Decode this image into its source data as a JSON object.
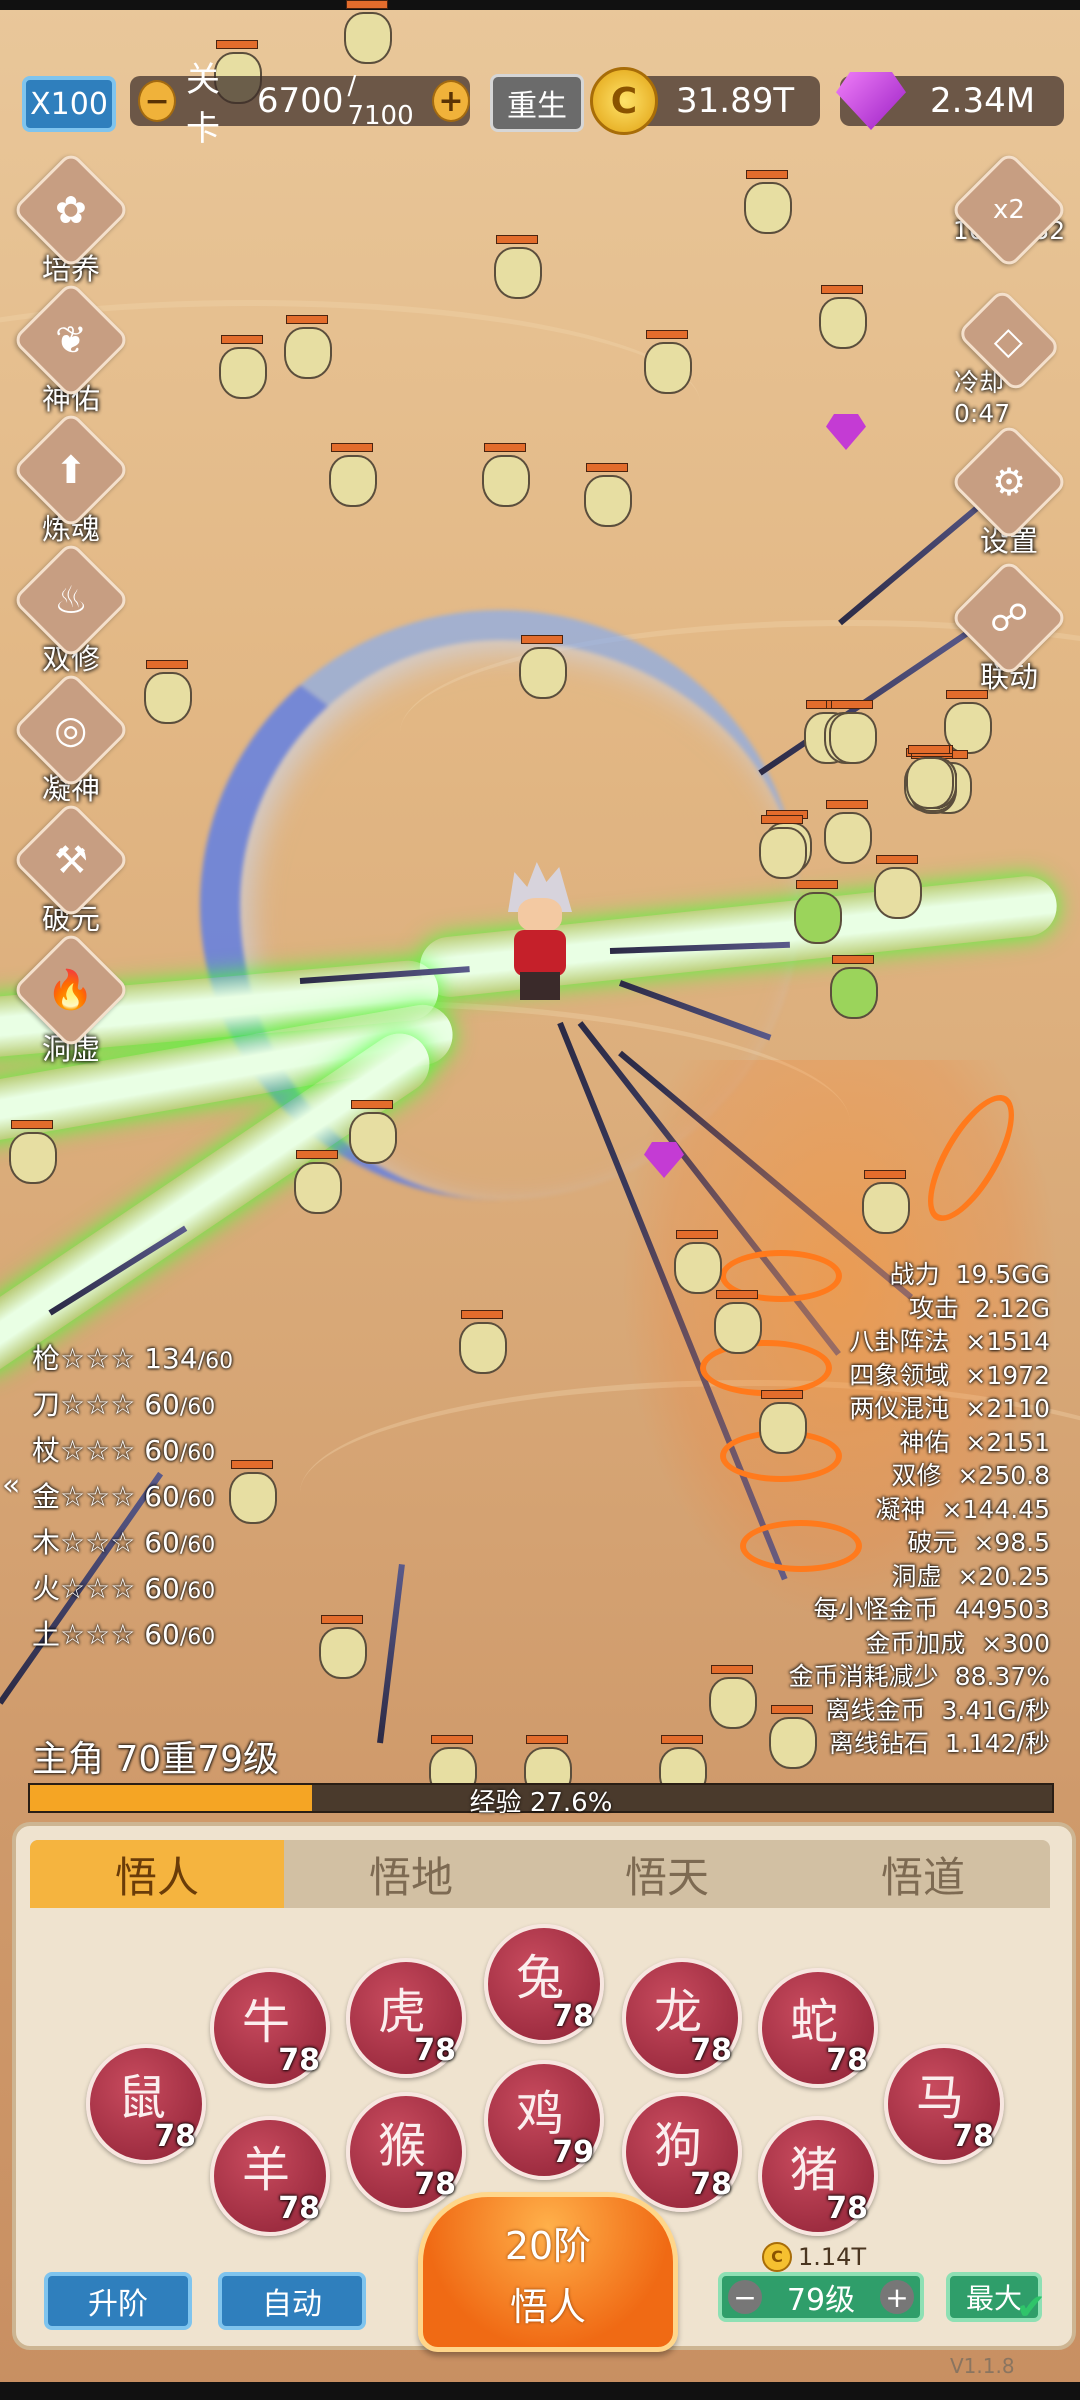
{
  "top_bar": {
    "speed_label": "X100",
    "stage_label": "关卡",
    "stage_current": "6700",
    "stage_max": "/ 7100",
    "rebirth_label": "重生",
    "gold_amount": "31.89T",
    "gem_amount": "2.34M"
  },
  "side_menu": [
    "培养",
    "神佑",
    "炼魂",
    "双修",
    "凝神",
    "破元",
    "洞虚"
  ],
  "right_menu": {
    "bonus_label": "x2",
    "bonus_timer": "16:00:32",
    "cooldown_label": "冷却 0:47",
    "settings_label": "设置",
    "link_label": "联动"
  },
  "weapon_stats": [
    {
      "name": "枪☆☆☆",
      "value": "134",
      "max": "/60"
    },
    {
      "name": "刀☆☆☆",
      "value": "60",
      "max": "/60"
    },
    {
      "name": "杖☆☆☆",
      "value": "60",
      "max": "/60"
    },
    {
      "name": "金☆☆☆",
      "value": "60",
      "max": "/60"
    },
    {
      "name": "木☆☆☆",
      "value": "60",
      "max": "/60"
    },
    {
      "name": "火☆☆☆",
      "value": "60",
      "max": "/60"
    },
    {
      "name": "土☆☆☆",
      "value": "60",
      "max": "/60"
    }
  ],
  "combat_stats": [
    {
      "label": "战力",
      "value": "19.5GG"
    },
    {
      "label": "攻击",
      "value": "2.12G"
    },
    {
      "label": "八卦阵法",
      "value": "×1514"
    },
    {
      "label": "四象领域",
      "value": "×1972"
    },
    {
      "label": "两仪混沌",
      "value": "×2110"
    },
    {
      "label": "神佑",
      "value": "×2151"
    },
    {
      "label": "双修",
      "value": "×250.8"
    },
    {
      "label": "凝神",
      "value": "×144.45"
    },
    {
      "label": "破元",
      "value": "×98.5"
    },
    {
      "label": "洞虚",
      "value": "×20.25"
    },
    {
      "label": "每小怪金币",
      "value": "449503"
    },
    {
      "label": "金币加成",
      "value": "×300"
    },
    {
      "label": "金币消耗减少",
      "value": "88.37%"
    },
    {
      "label": "离线金币",
      "value": "3.41G/秒"
    },
    {
      "label": "离线钻石",
      "value": "1.142/秒"
    }
  ],
  "hero": {
    "level_text": "主角 70重79级",
    "exp_text": "经验 27.6%",
    "exp_fraction": 0.276
  },
  "tabs": [
    "悟人",
    "悟地",
    "悟天",
    "悟道"
  ],
  "zodiac": [
    {
      "name": "rat",
      "glyph": "鼠",
      "level": "78"
    },
    {
      "name": "ox",
      "glyph": "牛",
      "level": "78"
    },
    {
      "name": "goat",
      "glyph": "羊",
      "level": "78"
    },
    {
      "name": "tiger",
      "glyph": "虎",
      "level": "78"
    },
    {
      "name": "monkey",
      "glyph": "猴",
      "level": "78"
    },
    {
      "name": "rabbit",
      "glyph": "兔",
      "level": "78"
    },
    {
      "name": "rooster",
      "glyph": "鸡",
      "level": "79"
    },
    {
      "name": "dragon",
      "glyph": "龙",
      "level": "78"
    },
    {
      "name": "dog",
      "glyph": "狗",
      "level": "78"
    },
    {
      "name": "snake",
      "glyph": "蛇",
      "level": "78"
    },
    {
      "name": "pig",
      "glyph": "猪",
      "level": "78"
    },
    {
      "name": "horse",
      "glyph": "马",
      "level": "78"
    }
  ],
  "actions": {
    "upgrade_label": "升阶",
    "auto_label": "自动",
    "main_line1": "20阶",
    "main_line2": "悟人",
    "cost": "1.14T",
    "level_value": "79级",
    "max_label": "最大"
  },
  "version": "V1.1.8",
  "colors": {
    "accent": "#f08a2c",
    "tab_active": "#f5b43f",
    "button_blue": "#2f7fbd",
    "button_green": "#2f9e6a"
  }
}
